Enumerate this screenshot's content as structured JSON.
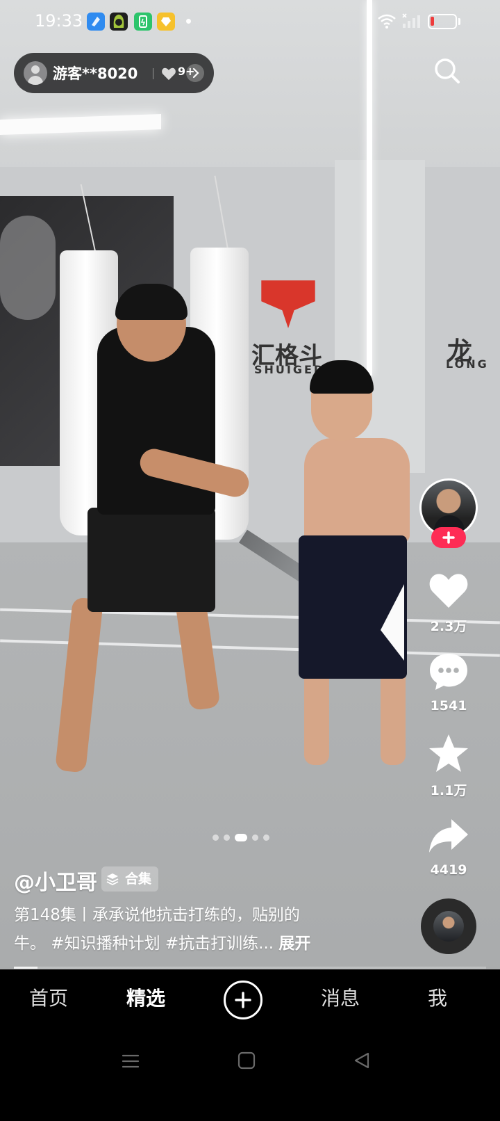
{
  "status_bar": {
    "time": "19:33",
    "battery_level": 0.15,
    "battery_color": "#ee3b3b",
    "icons": [
      "app-blue-icon",
      "app-dark-hood-icon",
      "app-green-icon",
      "app-yellow-heart-icon",
      "dot-icon",
      "wifi-icon",
      "signal-icon",
      "battery-icon"
    ]
  },
  "guest": {
    "name": "游客**8020",
    "heart_count": "9+",
    "icons": [
      "avatar-icon",
      "heart-icon",
      "chevron-right-icon"
    ]
  },
  "search": {
    "icon": "search-icon"
  },
  "rail": {
    "follow_icon": "plus-icon",
    "like_count": "2.3万",
    "comment_count": "1541",
    "favorite_count": "1.1万",
    "share_count": "4419",
    "accent_color": "#fe2c55"
  },
  "pager": {
    "count": 5,
    "active_index": 2
  },
  "video": {
    "author": "@小卫哥",
    "collection_label": "合集",
    "caption_line1": "第148集丨承承说他抗击打练的，贴别的",
    "caption_line2": "牛。 #知识播种计划 #抗击打训练...",
    "expand_label": "展开",
    "progress": 0.05,
    "wall_sign_1": "汇格斗",
    "wall_sign_1_sub": "SHUIGED",
    "wall_sign_2": "龙",
    "wall_sign_2_sub": "LONG"
  },
  "tabs": {
    "home": "首页",
    "featured": "精选",
    "messages": "消息",
    "me": "我",
    "post_icon": "plus-circle-icon"
  },
  "system_nav": [
    "menu-icon",
    "home-square-icon",
    "back-triangle-icon"
  ]
}
